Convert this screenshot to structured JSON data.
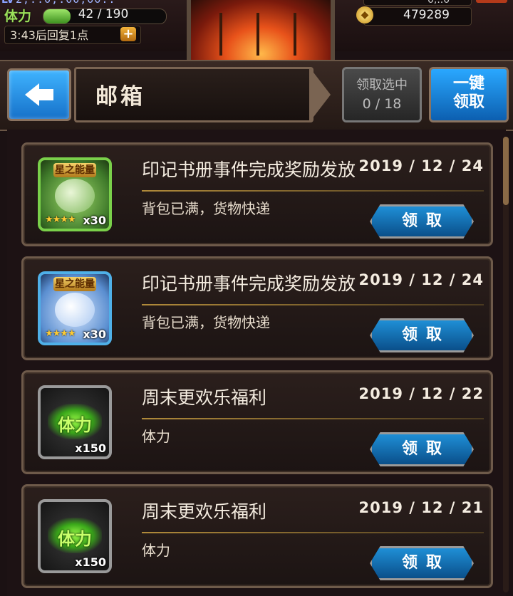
{
  "top_bar": {
    "level_tag": "LV",
    "exp_partial": "2,..0,.00,00..",
    "stamina_label": "体力",
    "stamina_text": "42 / 190",
    "stamina_fraction": 0.221,
    "recover_text": "3:43后回复1点",
    "recover_plus": "+",
    "currency_top_partial": "0,..0",
    "gold_amount": "479289",
    "gold_icon": "gold-coin-icon"
  },
  "header": {
    "back_icon": "back-arrow-icon",
    "title": "邮箱",
    "select_label": "领取选中",
    "select_count": "0 / 18",
    "claim_all_line1": "一键",
    "claim_all_line2": "领取"
  },
  "mails": [
    {
      "icon_type": "energy-green",
      "icon_banner": "星之能量",
      "icon_stars": "★★★★",
      "icon_qty": "x30",
      "title": "印记书册事件完成奖励发放",
      "date": "2019 / 12 / 24",
      "desc": "背包已满，货物快递",
      "claim_label": "领取"
    },
    {
      "icon_type": "energy-blue",
      "icon_banner": "星之能量",
      "icon_stars": "★★★★",
      "icon_qty": "x30",
      "title": "印记书册事件完成奖励发放",
      "date": "2019 / 12 / 24",
      "desc": "背包已满，货物快递",
      "claim_label": "领取"
    },
    {
      "icon_type": "stamina",
      "icon_word": "体力",
      "icon_qty": "x150",
      "title": "周末更欢乐福利",
      "date": "2019 / 12 / 22",
      "desc": "体力",
      "claim_label": "领取"
    },
    {
      "icon_type": "stamina",
      "icon_word": "体力",
      "icon_qty": "x150",
      "title": "周末更欢乐福利",
      "date": "2019 / 12 / 21",
      "desc": "体力",
      "claim_label": "领取"
    }
  ],
  "colors": {
    "accent_blue": "#1f8fd6",
    "frame": "#6e5a4a",
    "stamina_green": "#9be05a"
  }
}
